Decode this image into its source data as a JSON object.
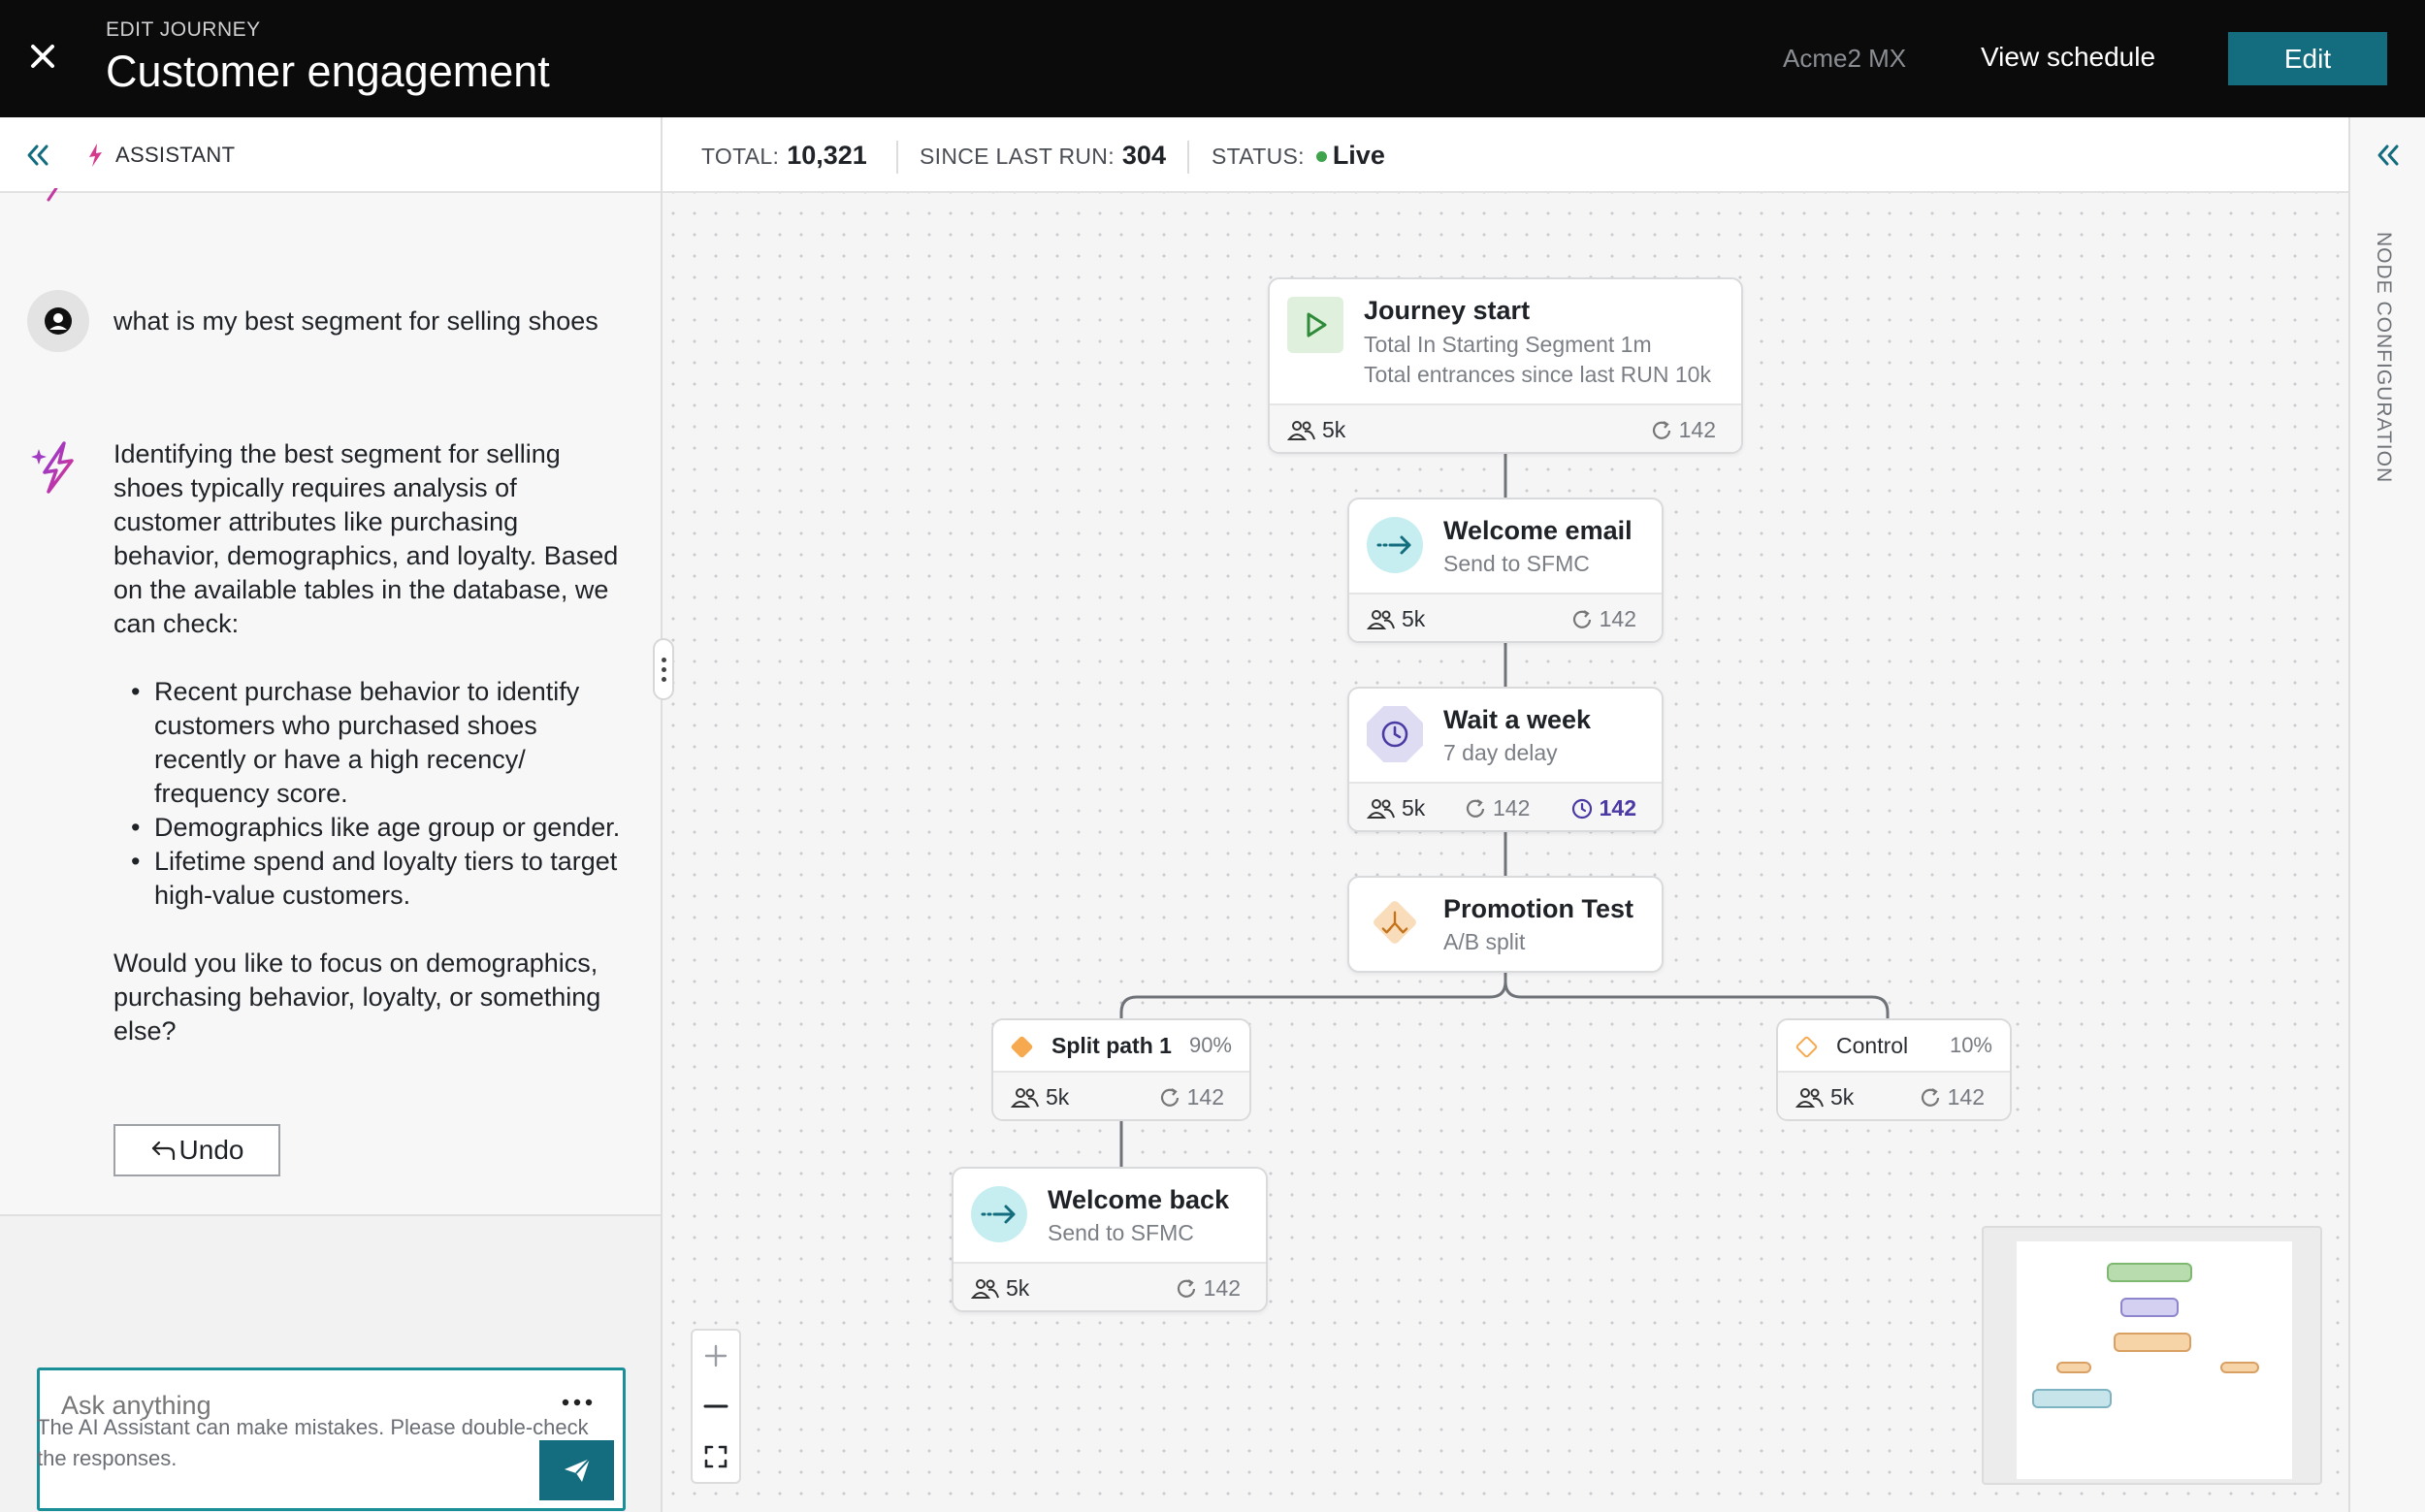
{
  "header": {
    "subtitle": "EDIT JOURNEY",
    "title": "Customer engagement",
    "org": "Acme2 MX",
    "view_schedule": "View schedule",
    "edit": "Edit"
  },
  "assistant": {
    "label": "ASSISTANT",
    "user_message": "what is my best segment for selling shoes",
    "ai_intro": "Identifying the best segment for selling shoes typically requires analysis of customer attributes like purchasing behavior, demographics, and loyalty. Based on the available tables in the database, we can check:",
    "ai_bullets": [
      "Recent purchase behavior to identify customers who purchased shoes recently or have a high recency/ frequency score.",
      "Demographics like age group or gender.",
      "Lifetime spend and loyalty tiers to target high-value customers."
    ],
    "ai_outro": "Would you like to focus on demographics, purchasing behavior, loyalty, or something else?",
    "undo": "Undo",
    "input_placeholder": "Ask anything",
    "disclaimer": "The AI Assistant can make mistakes. Please double-check the responses."
  },
  "stats": {
    "total_label": "TOTAL:",
    "total_value": "10,321",
    "since_label": "SINCE LAST RUN:",
    "since_value": "304",
    "status_label": "STATUS:",
    "status_value": "Live"
  },
  "right_rail": {
    "label": "NODE CONFIGURATION"
  },
  "nodes": {
    "start": {
      "title": "Journey start",
      "line1": "Total In Starting Segment 1m",
      "line2": "Total entrances since last RUN 10k",
      "count": "5k",
      "runs": "142"
    },
    "welcome_email": {
      "title": "Welcome email",
      "sub": "Send to SFMC",
      "count": "5k",
      "runs": "142"
    },
    "wait": {
      "title": "Wait a week",
      "sub": "7 day delay",
      "count": "5k",
      "runs": "142",
      "waiting": "142"
    },
    "promotion": {
      "title": "Promotion Test",
      "sub": "A/B split"
    },
    "split1": {
      "label": "Split path 1",
      "pct": "90%",
      "count": "5k",
      "runs": "142"
    },
    "control": {
      "label": "Control",
      "pct": "10%",
      "count": "5k",
      "runs": "142"
    },
    "welcome_back": {
      "title": "Welcome back",
      "sub": "Send to SFMC",
      "count": "5k",
      "runs": "142"
    }
  },
  "colors": {
    "accent": "#136d7e",
    "live": "#3ea34a",
    "start_green": "#dff1dc",
    "email_teal": "#c6eef0",
    "wait_purple": "#dedcf3",
    "split_orange": "#f9dcba"
  }
}
